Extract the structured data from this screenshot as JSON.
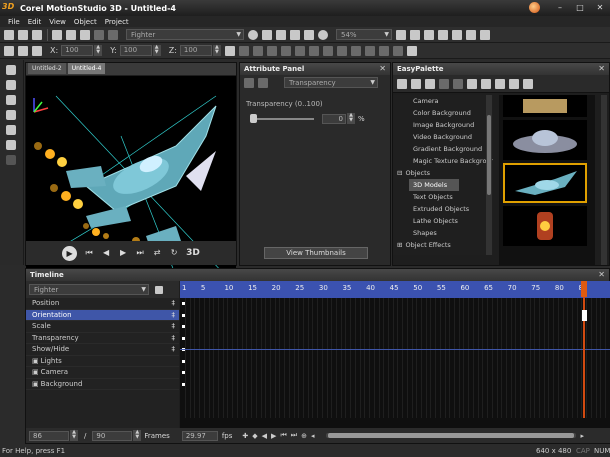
{
  "app": {
    "title": "Corel MotionStudio 3D - Untitled-4",
    "logo": "3D"
  },
  "window_controls": {
    "minimize": "–",
    "restore": "□",
    "close": "✕"
  },
  "menu": [
    "File",
    "Edit",
    "View",
    "Object",
    "Project"
  ],
  "toolbar": {
    "object_select": "Fighter",
    "zoom": "54%",
    "x_label": "X:",
    "x_value": "100",
    "y_label": "Y:",
    "y_value": "100",
    "z_label": "Z:",
    "z_value": "100"
  },
  "viewport": {
    "tabs": [
      "Untitled-2",
      "Untitled-4"
    ],
    "transport_3d": "3D"
  },
  "attribute_panel": {
    "title": "Attribute Panel",
    "property_select": "Transparency",
    "label": "Transparency (0..100)",
    "value": "0",
    "unit": "%",
    "view_thumbnails": "View Thumbnails"
  },
  "easy_palette": {
    "title": "EasyPalette",
    "tree": [
      {
        "label": "Camera",
        "indent": 2,
        "selected": false
      },
      {
        "label": "Color Background",
        "indent": 2,
        "selected": false
      },
      {
        "label": "Image Background",
        "indent": 2,
        "selected": false
      },
      {
        "label": "Video Background",
        "indent": 2,
        "selected": false
      },
      {
        "label": "Gradient Background",
        "indent": 2,
        "selected": false
      },
      {
        "label": "Magic Texture Backgrour",
        "indent": 2,
        "selected": false
      },
      {
        "label": "Objects",
        "indent": 1,
        "selected": false,
        "expander": "⊟"
      },
      {
        "label": "3D Models",
        "indent": 2,
        "selected": true
      },
      {
        "label": "Text Objects",
        "indent": 2,
        "selected": false
      },
      {
        "label": "Extruded Objects",
        "indent": 2,
        "selected": false
      },
      {
        "label": "Lathe Objects",
        "indent": 2,
        "selected": false
      },
      {
        "label": "Shapes",
        "indent": 2,
        "selected": false
      },
      {
        "label": "Object Effects",
        "indent": 1,
        "selected": false,
        "expander": "⊞"
      }
    ]
  },
  "timeline": {
    "title": "Timeline",
    "object_select": "Fighter",
    "tracks": [
      {
        "label": "Position",
        "selected": false,
        "pin": "‡",
        "icon": ""
      },
      {
        "label": "Orientation",
        "selected": true,
        "pin": "‡",
        "icon": ""
      },
      {
        "label": "Scale",
        "selected": false,
        "pin": "‡",
        "icon": ""
      },
      {
        "label": "Transparency",
        "selected": false,
        "pin": "‡",
        "icon": ""
      },
      {
        "label": "Show/Hide",
        "selected": false,
        "pin": "‡",
        "icon": ""
      },
      {
        "label": "Lights",
        "selected": false,
        "pin": "",
        "icon": "▣"
      },
      {
        "label": "Camera",
        "selected": false,
        "pin": "",
        "icon": "▣"
      },
      {
        "label": "Background",
        "selected": false,
        "pin": "",
        "icon": "▣"
      }
    ],
    "ruler_labels": [
      "1",
      "5",
      "10",
      "15",
      "20",
      "25",
      "30",
      "35",
      "40",
      "45",
      "50",
      "55",
      "60",
      "65",
      "70",
      "75",
      "80",
      "85"
    ],
    "current_frame": "86",
    "separator": "/",
    "total_frames": "90",
    "frames_label": "Frames",
    "fps_value": "29.97",
    "fps_label": "fps"
  },
  "statusbar": {
    "help": "For Help, press F1",
    "size": "640 x 480",
    "caps": "CAP",
    "num": "NUM"
  },
  "colors": {
    "accent_blue": "#3f56a8",
    "playhead": "#d24a10",
    "thumb_selection": "#e0a000"
  }
}
